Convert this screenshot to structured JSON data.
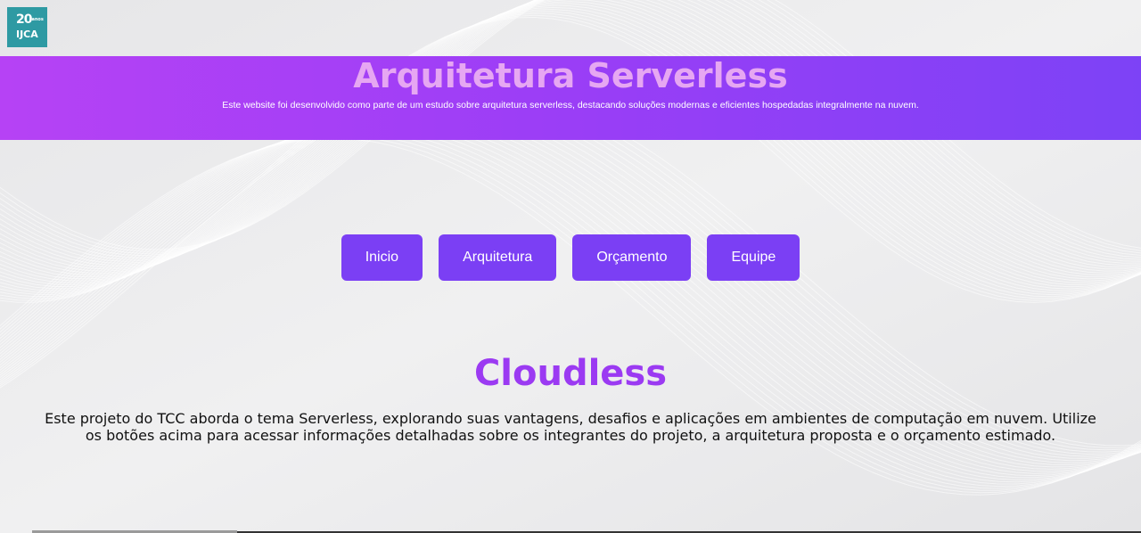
{
  "logo": {
    "line1": "20",
    "line1_small": "anos",
    "line2": "IJCA",
    "color": "#2e9aa3"
  },
  "header": {
    "title": "Arquitetura Serverless",
    "subtitle": "Este website foi desenvolvido como parte de um estudo sobre arquitetura serverless, destacando soluções modernas e eficientes hospedadas integralmente na nuvem.",
    "gradient_start": "#b642f5",
    "gradient_end": "#7d42f6"
  },
  "nav": {
    "items": [
      {
        "label": "Inicio"
      },
      {
        "label": "Arquitetura"
      },
      {
        "label": "Orçamento"
      },
      {
        "label": "Equipe"
      }
    ],
    "button_color": "#7b3ff4"
  },
  "main": {
    "heading": "Cloudless",
    "description": "Este projeto do TCC aborda o tema Serverless, explorando suas vantagens, desafios e aplicações em ambientes de computação em nuvem. Utilize os botões acima para acessar informações detalhadas sobre os integrantes do projeto, a arquitetura proposta e o orçamento estimado.",
    "heading_color": "#9b3af2"
  }
}
